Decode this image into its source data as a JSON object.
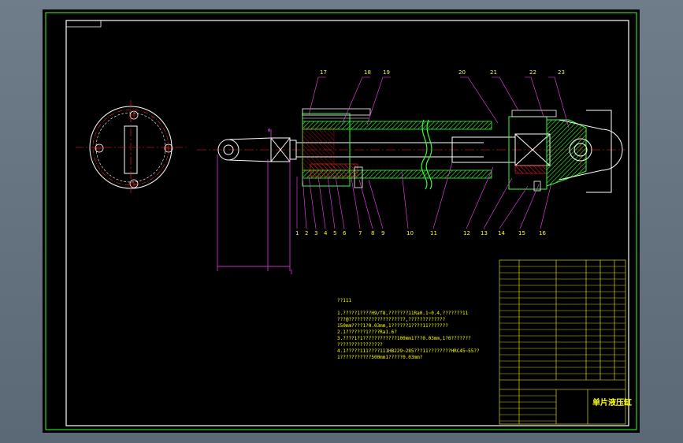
{
  "drawing": {
    "title_block_name": "单片液压缸",
    "balloon_labels_top": [
      "17",
      "18",
      "19",
      "20",
      "21",
      "22",
      "23"
    ],
    "balloon_labels_bottom": [
      "1",
      "2",
      "3",
      "4",
      "5",
      "6",
      "7",
      "8",
      "9",
      "10",
      "11",
      "12",
      "13",
      "14",
      "15",
      "16"
    ],
    "notes_heading": "??111",
    "notes_lines": [
      "1.?????1????H9/f8,???????11Ra0.1~0.4,???????11",
      "???@????????????????????,?????????????",
      "150mm????1?0.03mm,1??????1????11???????",
      "2.1???????1????Ra1.6?",
      "3.????1?1????????????100mm1???0.03mm,1?0???????",
      "????????????????",
      "4.1?????111????111HB229~285???11????????HRC45~55??",
      "1???????????500mm1?????0.03mm?"
    ],
    "dimension_label": "Φ"
  },
  "colors": {
    "background_frame": "#66737f",
    "paper": "#000000",
    "border": "#ffffff",
    "green": "#33ff33",
    "red": "#ff2020",
    "yellow": "#ffff00",
    "magenta": "#ff40ff"
  }
}
